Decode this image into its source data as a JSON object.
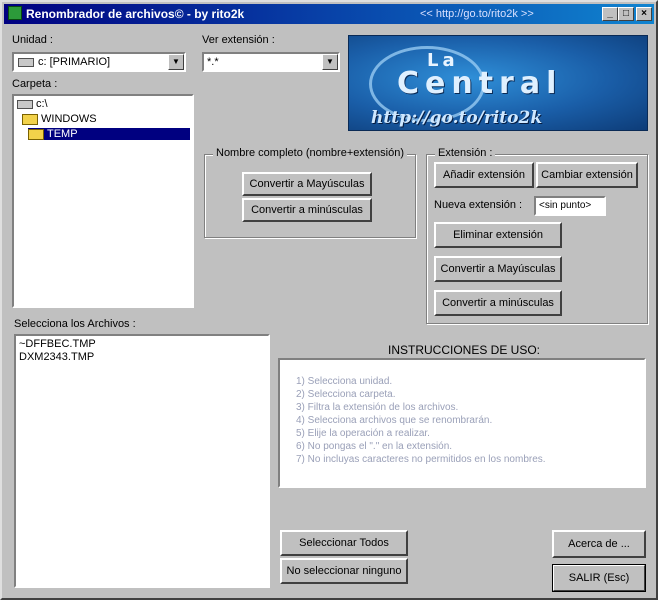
{
  "window": {
    "title": "Renombrador de archivos© - by rito2k",
    "url_text": "<< http://go.to/rito2k >>",
    "controls": [
      "_",
      "□",
      "×"
    ]
  },
  "unidad": {
    "label": "Unidad :",
    "value": "c: [PRIMARIO]"
  },
  "ver_extension": {
    "label": "Ver extensión :",
    "value": "*.*"
  },
  "carpeta": {
    "label": "Carpeta :",
    "items": [
      {
        "name": "c:\\",
        "icon": "drive-icon"
      },
      {
        "name": "WINDOWS",
        "icon": "open-folder-icon"
      },
      {
        "name": "TEMP",
        "icon": "open-folder-icon"
      }
    ]
  },
  "logo": {
    "la": "La",
    "central": "Central",
    "url": "http://go.to/rito2k"
  },
  "nombre_completo": {
    "legend": "Nombre completo (nombre+extensión)",
    "upper_button": "Convertir a Mayúsculas",
    "lower_button": "Convertir a minúsculas"
  },
  "extension": {
    "legend": "Extensión :",
    "add_button": "Añadir extensión",
    "change_button": "Cambiar extensión",
    "new_label": "Nueva extensión :",
    "new_value": "<sin punto>",
    "remove_button": "Eliminar extensión",
    "upper_button": "Convertir a Mayúsculas",
    "lower_button": "Convertir a minúsculas"
  },
  "files": {
    "label": "Selecciona los Archivos :",
    "items": [
      "~DFFBEC.TMP",
      "DXM2343.TMP"
    ]
  },
  "instructions": {
    "title": "INSTRUCCIONES DE USO:",
    "lines": [
      "1) Selecciona unidad.",
      "2) Selecciona carpeta.",
      "3) Filtra la extensión de los archivos.",
      "4) Selecciona archivos que se renombrarán.",
      "5) Elije la operación a realizar.",
      "6) No pongas el \".\" en la extensión.",
      "7) No incluyas caracteres no permitidos en los nombres."
    ]
  },
  "buttons": {
    "select_all": "Seleccionar Todos",
    "select_none": "No seleccionar ninguno",
    "about": "Acerca de ...",
    "exit": "SALIR (Esc)"
  }
}
